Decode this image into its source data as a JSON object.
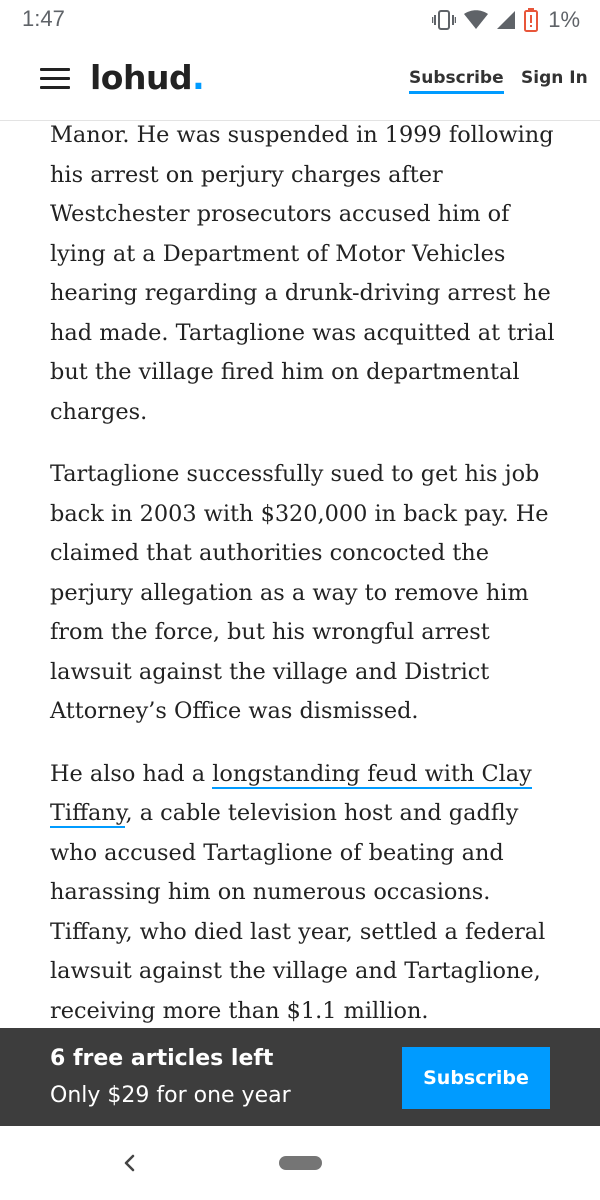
{
  "status_bar": {
    "time": "1:47",
    "battery_percent": "1%",
    "icons": [
      "vibrate-icon",
      "wifi-icon",
      "signal-icon",
      "battery-low-icon"
    ]
  },
  "header": {
    "logo_text": "lohud",
    "logo_dot": ".",
    "subscribe_label": "Subscribe",
    "signin_label": "Sign In",
    "accent_color": "#009bff"
  },
  "article": {
    "p1": "Manor. He was suspended in 1999 following his arrest on perjury charges after Westchester prosecutors accused him of lying at a Department of Motor Vehicles hearing regarding a drunk-driving arrest he had made. Tartaglione was acquitted at trial but the village fired him on departmental charges.",
    "p2": "Tartaglione successfully sued to get his job back in 2003 with $320,000 in back pay. He claimed that authorities concocted the perjury allegation as a way to remove him from the force, but his wrongful arrest lawsuit against the village and District Attorney’s Office was dismissed.",
    "p3_before": "He also had a ",
    "p3_link": "longstanding feud with Clay Tiffany",
    "p3_after": ", a cable television host and gadfly who accused Tartaglione of beating and harassing him on numerous occasions. Tiffany, who died last year, settled a federal lawsuit against the village and Tartaglione, receiving more than $1.1 million."
  },
  "paywall": {
    "title": "6 free articles left",
    "subtitle": "Only $29 for one year",
    "button_label": "Subscribe",
    "background_color": "#3d3d3d"
  },
  "nav_bar": {
    "icons": [
      "back-icon",
      "home-pill-icon"
    ]
  }
}
